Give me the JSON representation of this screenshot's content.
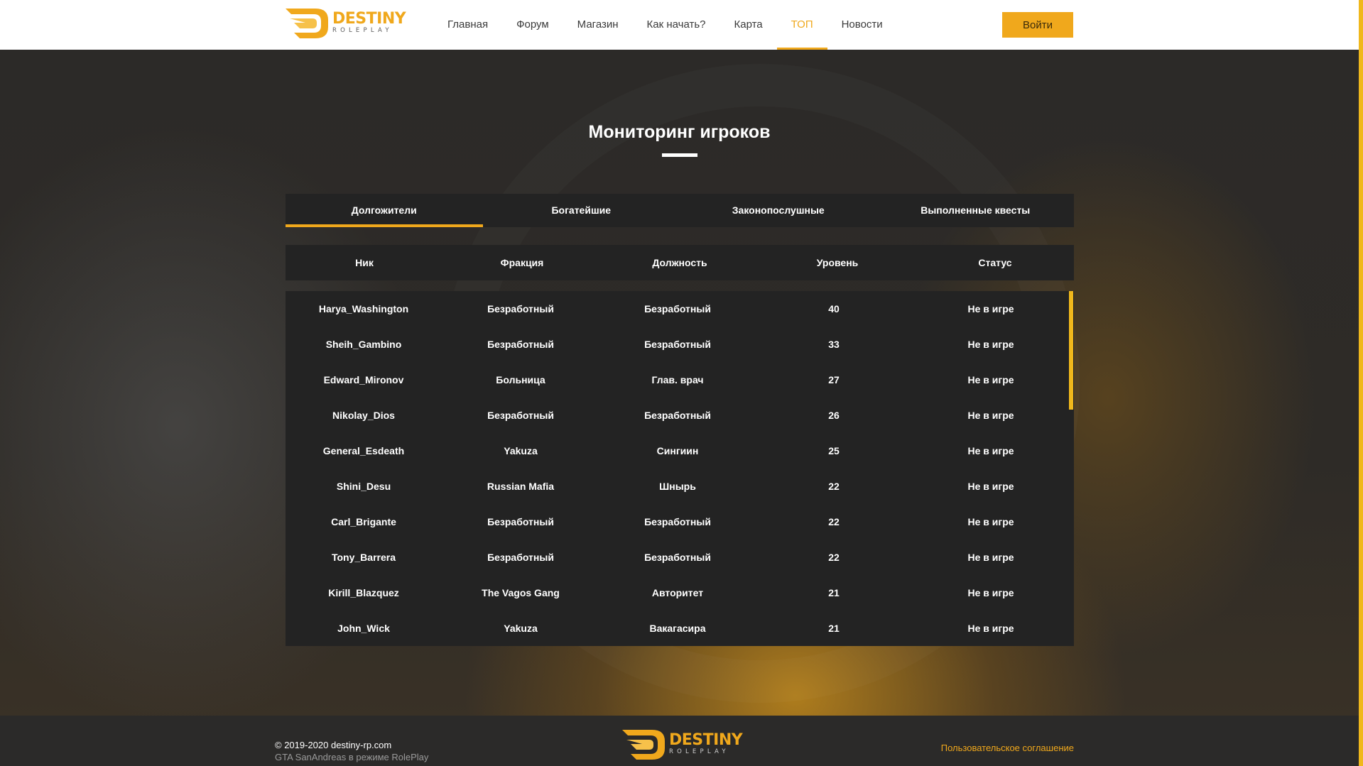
{
  "brand": {
    "name": "DESTINY",
    "sub": "ROLEPLAY",
    "accent_color": "#f0a81c",
    "logo_icon": "destiny-logo-icon"
  },
  "nav": {
    "items": [
      {
        "label": "Главная"
      },
      {
        "label": "Форум"
      },
      {
        "label": "Магазин"
      },
      {
        "label": "Как начать?"
      },
      {
        "label": "Карта"
      },
      {
        "label": "ТОП",
        "active": true
      },
      {
        "label": "Новости"
      }
    ],
    "login_label": "Войти"
  },
  "page": {
    "title": "Мониторинг игроков"
  },
  "tabs": [
    {
      "label": "Долгожители",
      "active": true
    },
    {
      "label": "Богатейшие"
    },
    {
      "label": "Законопослушные"
    },
    {
      "label": "Выполненные квесты"
    }
  ],
  "table": {
    "columns": [
      "Ник",
      "Фракция",
      "Должность",
      "Уровень",
      "Статус"
    ],
    "rows": [
      [
        "Harya_Washington",
        "Безработный",
        "Безработный",
        "40",
        "Не в игре"
      ],
      [
        "Sheih_Gambino",
        "Безработный",
        "Безработный",
        "33",
        "Не в игре"
      ],
      [
        "Edward_Mironov",
        "Больница",
        "Глав. врач",
        "27",
        "Не в игре"
      ],
      [
        "Nikolay_Dios",
        "Безработный",
        "Безработный",
        "26",
        "Не в игре"
      ],
      [
        "General_Esdeath",
        "Yakuza",
        "Сингиин",
        "25",
        "Не в игре"
      ],
      [
        "Shini_Desu",
        "Russian Mafia",
        "Шнырь",
        "22",
        "Не в игре"
      ],
      [
        "Carl_Brigante",
        "Безработный",
        "Безработный",
        "22",
        "Не в игре"
      ],
      [
        "Tony_Barrera",
        "Безработный",
        "Безработный",
        "22",
        "Не в игре"
      ],
      [
        "Kirill_Blazquez",
        "The Vagos Gang",
        "Авторитет",
        "21",
        "Не в игре"
      ],
      [
        "John_Wick",
        "Yakuza",
        "Вакагасира",
        "21",
        "Не в игре"
      ]
    ]
  },
  "footer": {
    "copyright": "© 2019-2020 destiny-rp.com",
    "subtitle": "GTA SanAndreas в режиме RolePlay",
    "agreement": "Пользовательское соглашение"
  }
}
